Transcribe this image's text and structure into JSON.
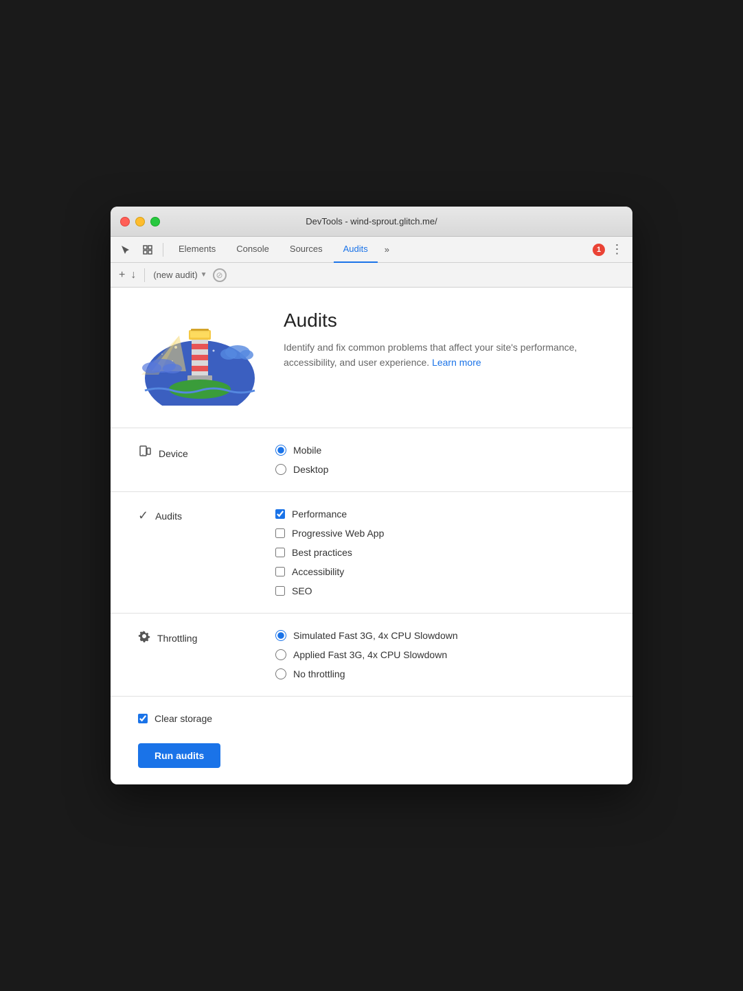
{
  "window": {
    "title": "DevTools - wind-sprout.glitch.me/"
  },
  "tabs": {
    "items": [
      {
        "label": "Elements",
        "active": false
      },
      {
        "label": "Console",
        "active": false
      },
      {
        "label": "Sources",
        "active": false
      },
      {
        "label": "Audits",
        "active": true
      }
    ],
    "more_label": "»",
    "error_count": "1"
  },
  "secondary_toolbar": {
    "audit_placeholder": "(new audit)"
  },
  "hero": {
    "title": "Audits",
    "description": "Identify and fix common problems that affect your site's performance, accessibility, and user experience.",
    "learn_more": "Learn more"
  },
  "device_section": {
    "label": "Device",
    "options": [
      {
        "label": "Mobile",
        "value": "mobile",
        "checked": true
      },
      {
        "label": "Desktop",
        "value": "desktop",
        "checked": false
      }
    ]
  },
  "audits_section": {
    "label": "Audits",
    "options": [
      {
        "label": "Performance",
        "checked": true
      },
      {
        "label": "Progressive Web App",
        "checked": false
      },
      {
        "label": "Best practices",
        "checked": false
      },
      {
        "label": "Accessibility",
        "checked": false
      },
      {
        "label": "SEO",
        "checked": false
      }
    ]
  },
  "throttling_section": {
    "label": "Throttling",
    "options": [
      {
        "label": "Simulated Fast 3G, 4x CPU Slowdown",
        "value": "simulated",
        "checked": true
      },
      {
        "label": "Applied Fast 3G, 4x CPU Slowdown",
        "value": "applied",
        "checked": false
      },
      {
        "label": "No throttling",
        "value": "none",
        "checked": false
      }
    ]
  },
  "bottom_section": {
    "clear_storage_label": "Clear storage",
    "clear_storage_checked": true,
    "run_button_label": "Run audits"
  },
  "colors": {
    "active_tab": "#1a73e8",
    "run_button": "#1a73e8"
  }
}
